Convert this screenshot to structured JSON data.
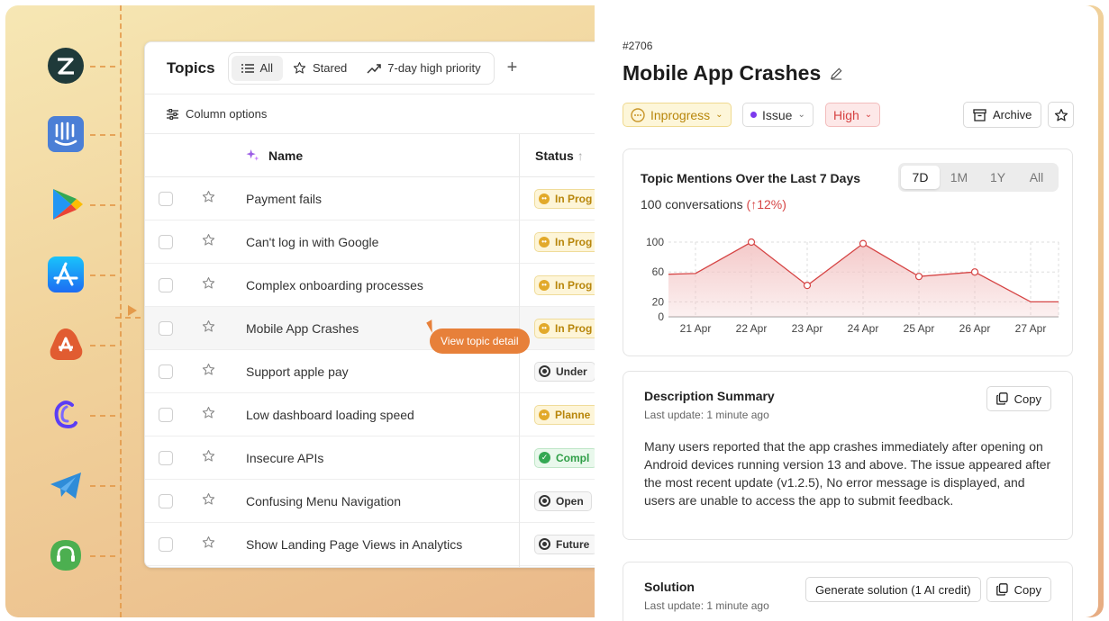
{
  "integrations": [
    {
      "name": "zendesk-icon",
      "color": "#1f3a3a"
    },
    {
      "name": "intercom-icon",
      "color": "#4b7fd6"
    },
    {
      "name": "google-play-icon",
      "color": "#34a853"
    },
    {
      "name": "app-store-icon",
      "color": "#1f7ef2"
    },
    {
      "name": "reviews-icon",
      "color": "#e15c31"
    },
    {
      "name": "crisp-icon",
      "color": "#5b3df5"
    },
    {
      "name": "telegram-icon",
      "color": "#2f8cd8"
    },
    {
      "name": "support-headset-icon",
      "color": "#4caf50"
    }
  ],
  "topics": {
    "title": "Topics",
    "tabs": [
      {
        "label": "All",
        "icon": "list-icon",
        "active": true
      },
      {
        "label": "Stared",
        "icon": "star-icon",
        "active": false
      },
      {
        "label": "7-day high priority",
        "icon": "trend-up-icon",
        "active": false
      }
    ],
    "add_label": "+",
    "column_options_label": "Column options",
    "columns": {
      "name": "Name",
      "status": "Status"
    },
    "rows": [
      {
        "name": "Payment fails",
        "status": "In Prog",
        "kind": "prog"
      },
      {
        "name": "Can't log in with Google",
        "status": "In Prog",
        "kind": "prog"
      },
      {
        "name": "Complex onboarding processes",
        "status": "In Prog",
        "kind": "prog"
      },
      {
        "name": "Mobile App Crashes",
        "status": "In Prog",
        "kind": "prog"
      },
      {
        "name": "Support apple pay",
        "status": "Under",
        "kind": "under"
      },
      {
        "name": "Low dashboard loading speed",
        "status": "Planne",
        "kind": "plan"
      },
      {
        "name": "Insecure APIs",
        "status": "Compl",
        "kind": "comp"
      },
      {
        "name": "Confusing Menu Navigation",
        "status": "Open",
        "kind": "open"
      },
      {
        "name": "Show Landing Page Views in Analytics",
        "status": "Future",
        "kind": "future"
      }
    ],
    "tooltip": "View topic detail"
  },
  "detail": {
    "id": "#2706",
    "title": "Mobile App Crashes",
    "status_chip": "Inprogress",
    "type_chip": "Issue",
    "priority_chip": "High",
    "archive_label": "Archive",
    "chart_card": {
      "title": "Topic Mentions Over the Last 7 Days",
      "conversations": "100 conversations",
      "change": "(↑12%)",
      "ranges": [
        "7D",
        "1M",
        "1Y",
        "All"
      ],
      "active_range": "7D"
    },
    "description": {
      "title": "Description Summary",
      "updated": "Last update: 1 minute ago",
      "copy_label": "Copy",
      "text": "Many users reported that the app crashes immediately after opening on Android devices running version 13 and above. The issue appeared after the most recent update (v1.2.5), No error message is displayed, and users are unable to access the app to submit feedback."
    },
    "solution": {
      "title": "Solution",
      "updated": "Last update: 1 minute ago",
      "generate_label": "Generate solution (1 AI credit)",
      "copy_label": "Copy"
    }
  },
  "chart_data": {
    "type": "area",
    "x": [
      "21 Apr",
      "22 Apr",
      "23 Apr",
      "24 Apr",
      "25 Apr",
      "26 Apr",
      "27 Apr"
    ],
    "series": [
      {
        "values": [
          58,
          100,
          42,
          98,
          54,
          60,
          20
        ]
      }
    ],
    "x_start": 57,
    "x_end": 20,
    "yticks": [
      0,
      20,
      60,
      100
    ],
    "ylim": [
      0,
      100
    ],
    "grid": true,
    "line_color": "#d64545",
    "fill_color": "#f3c6c6"
  }
}
